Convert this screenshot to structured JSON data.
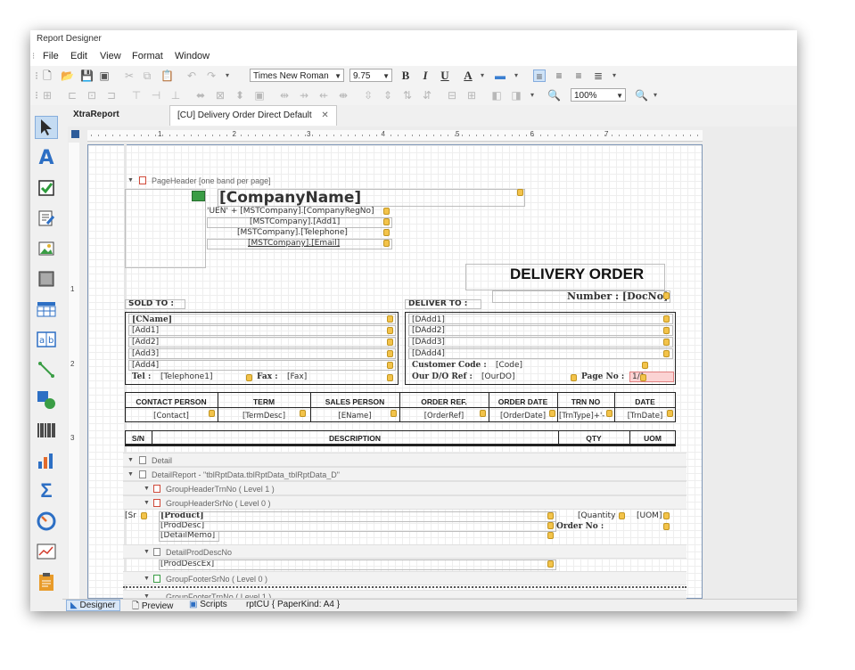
{
  "window": {
    "title": "Report Designer"
  },
  "menu": [
    "File",
    "Edit",
    "View",
    "Format",
    "Window"
  ],
  "toolbar": {
    "font_name": "Times New Roman",
    "font_size": "9.75",
    "bold": "B",
    "italic": "I",
    "underline": "U",
    "font_color": "A",
    "zoom": "100%"
  },
  "tabs": [
    "XtraReport",
    "[CU] Delivery Order Direct Default"
  ],
  "ruler": {
    "h": [
      "1",
      "2",
      "3",
      "4",
      "5",
      "6",
      "7"
    ],
    "v": [
      "1",
      "2",
      "3"
    ]
  },
  "bands": {
    "page_header": "PageHeader [one band per page]",
    "detail": "Detail",
    "detail_report": "DetailReport - \"tblRptData.tblRptData_tblRptData_D\"",
    "group_header_trn": "GroupHeaderTrnNo ( Level 1 )",
    "group_header_sr": "GroupHeaderSrNo ( Level 0 )",
    "detail_prod": "DetailProdDescNo",
    "group_footer_sr": "GroupFooterSrNo ( Level 0 )",
    "group_footer_trn": "GroupFooterTrnNo ( Level 1 )"
  },
  "header": {
    "company_name": "[CompanyName]",
    "reg_no": "'UEN' + [MSTCompany].[CompanyRegNo]",
    "add1": "[MSTCompany].[Add1]",
    "telephone": "[MSTCompany].[Telephone]",
    "email": "[MSTCompany].[Email]",
    "title": "DELIVERY ORDER",
    "number": "Number : [DocNo]"
  },
  "sold_to": {
    "label": "SOLD TO :",
    "lines": [
      "[CName]",
      "[Add1]",
      "[Add2]",
      "[Add3]",
      "[Add4]"
    ],
    "tel_label": "Tel :",
    "tel": "[Telephone1]",
    "fax_label": "Fax :",
    "fax": "[Fax]"
  },
  "deliver_to": {
    "label": "DELIVER TO :",
    "lines": [
      "[DAdd1]",
      "[DAdd2]",
      "[DAdd3]",
      "[DAdd4]"
    ],
    "cust_label": "Customer Code :",
    "cust": "[Code]",
    "do_label": "Our D/O Ref :",
    "do": "[OurDO]",
    "page_label": "Page No :",
    "page": "1/1"
  },
  "info_table": {
    "headers": [
      "CONTACT PERSON",
      "TERM",
      "SALES PERSON",
      "ORDER REF.",
      "ORDER DATE",
      "TRN NO",
      "DATE"
    ],
    "values": [
      "[Contact]",
      "[TermDesc]",
      "[EName]",
      "[OrderRef]",
      "[OrderDate]",
      "[TrnType]+'-",
      "[TrnDate]"
    ]
  },
  "item_header": {
    "sn": "S/N",
    "desc": "DESCRIPTION",
    "qty": "QTY",
    "uom": "UOM"
  },
  "detail_fields": {
    "sr": "[Sr",
    "product": "[Product]",
    "prod_desc": "[ProdDesc]",
    "detail_memo": "[DetailMemo]",
    "quantity": "[Quantity",
    "uom": "[UOM]",
    "order_no": "Order No :",
    "prod_desc_ex": "[ProdDescEx]"
  },
  "status": {
    "designer": "Designer",
    "preview": "Preview",
    "scripts": "Scripts",
    "paper": "rptCU { PaperKind: A4 }"
  }
}
